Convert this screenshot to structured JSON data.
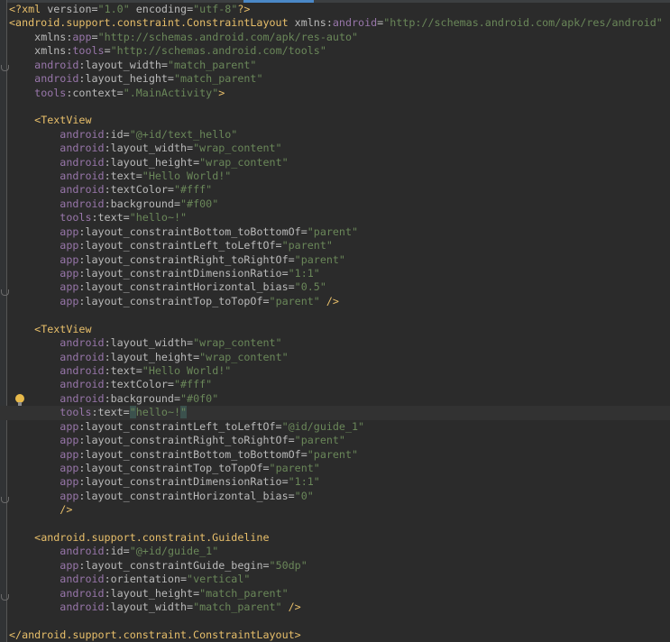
{
  "editor": {
    "lines": [
      {
        "i": 0,
        "k": [
          [
            "t",
            "<?xml "
          ],
          [
            "a",
            "version"
          ],
          [
            "a",
            "="
          ],
          [
            "v",
            "\"1.0\""
          ],
          [
            "a",
            " encoding"
          ],
          [
            "a",
            "="
          ],
          [
            "v",
            "\"utf-8\""
          ],
          [
            "t",
            "?>"
          ]
        ]
      },
      {
        "i": 0,
        "k": [
          [
            "t",
            "<android.support.constraint.ConstraintLayout "
          ],
          [
            "a",
            "xmlns"
          ],
          [
            "a",
            ":"
          ],
          [
            "n",
            "android"
          ],
          [
            "a",
            "="
          ],
          [
            "v",
            "\"http://schemas.android.com/apk/res/android\""
          ]
        ]
      },
      {
        "i": 1,
        "k": [
          [
            "a",
            "xmlns:"
          ],
          [
            "n",
            "app"
          ],
          [
            "a",
            "="
          ],
          [
            "v",
            "\"http://schemas.android.com/apk/res-auto\""
          ]
        ]
      },
      {
        "i": 1,
        "k": [
          [
            "a",
            "xmlns:"
          ],
          [
            "n",
            "tools"
          ],
          [
            "a",
            "="
          ],
          [
            "v",
            "\"http://schemas.android.com/tools\""
          ]
        ]
      },
      {
        "i": 1,
        "k": [
          [
            "n",
            "android"
          ],
          [
            "a",
            ":layout_width="
          ],
          [
            "v",
            "\"match_parent\""
          ]
        ]
      },
      {
        "i": 1,
        "k": [
          [
            "n",
            "android"
          ],
          [
            "a",
            ":layout_height="
          ],
          [
            "v",
            "\"match_parent\""
          ]
        ]
      },
      {
        "i": 1,
        "k": [
          [
            "n",
            "tools"
          ],
          [
            "a",
            ":context="
          ],
          [
            "v",
            "\".MainActivity\""
          ],
          [
            "t",
            ">"
          ]
        ]
      },
      {
        "i": 0,
        "k": []
      },
      {
        "i": 1,
        "k": [
          [
            "t",
            "<TextView"
          ]
        ]
      },
      {
        "i": 2,
        "k": [
          [
            "n",
            "android"
          ],
          [
            "a",
            ":id="
          ],
          [
            "v",
            "\"@+id/text_hello\""
          ]
        ]
      },
      {
        "i": 2,
        "k": [
          [
            "n",
            "android"
          ],
          [
            "a",
            ":layout_width="
          ],
          [
            "v",
            "\"wrap_content\""
          ]
        ]
      },
      {
        "i": 2,
        "k": [
          [
            "n",
            "android"
          ],
          [
            "a",
            ":layout_height="
          ],
          [
            "v",
            "\"wrap_content\""
          ]
        ]
      },
      {
        "i": 2,
        "k": [
          [
            "n",
            "android"
          ],
          [
            "a",
            ":text="
          ],
          [
            "v",
            "\"Hello World!\""
          ]
        ]
      },
      {
        "i": 2,
        "k": [
          [
            "n",
            "android"
          ],
          [
            "a",
            ":textColor="
          ],
          [
            "v",
            "\"#fff\""
          ]
        ]
      },
      {
        "i": 2,
        "k": [
          [
            "n",
            "android"
          ],
          [
            "a",
            ":background="
          ],
          [
            "v",
            "\"#f00\""
          ]
        ]
      },
      {
        "i": 2,
        "k": [
          [
            "n",
            "tools"
          ],
          [
            "a",
            ":text="
          ],
          [
            "v",
            "\"hello~!\""
          ]
        ]
      },
      {
        "i": 2,
        "k": [
          [
            "n",
            "app"
          ],
          [
            "a",
            ":layout_constraintBottom_toBottomOf="
          ],
          [
            "v",
            "\"parent\""
          ]
        ]
      },
      {
        "i": 2,
        "k": [
          [
            "n",
            "app"
          ],
          [
            "a",
            ":layout_constraintLeft_toLeftOf="
          ],
          [
            "v",
            "\"parent\""
          ]
        ]
      },
      {
        "i": 2,
        "k": [
          [
            "n",
            "app"
          ],
          [
            "a",
            ":layout_constraintRight_toRightOf="
          ],
          [
            "v",
            "\"parent\""
          ]
        ]
      },
      {
        "i": 2,
        "k": [
          [
            "n",
            "app"
          ],
          [
            "a",
            ":layout_constraintDimensionRatio="
          ],
          [
            "v",
            "\"1:1\""
          ]
        ]
      },
      {
        "i": 2,
        "k": [
          [
            "n",
            "app"
          ],
          [
            "a",
            ":layout_constraintHorizontal_bias="
          ],
          [
            "v",
            "\"0.5\""
          ]
        ]
      },
      {
        "i": 2,
        "k": [
          [
            "n",
            "app"
          ],
          [
            "a",
            ":layout_constraintTop_toTopOf="
          ],
          [
            "v",
            "\"parent\""
          ],
          [
            "t",
            " />"
          ]
        ]
      },
      {
        "i": 0,
        "k": []
      },
      {
        "i": 1,
        "k": [
          [
            "t",
            "<TextView"
          ]
        ]
      },
      {
        "i": 2,
        "k": [
          [
            "n",
            "android"
          ],
          [
            "a",
            ":layout_width="
          ],
          [
            "v",
            "\"wrap_content\""
          ]
        ]
      },
      {
        "i": 2,
        "k": [
          [
            "n",
            "android"
          ],
          [
            "a",
            ":layout_height="
          ],
          [
            "v",
            "\"wrap_content\""
          ]
        ]
      },
      {
        "i": 2,
        "k": [
          [
            "n",
            "android"
          ],
          [
            "a",
            ":text="
          ],
          [
            "v",
            "\"Hello World!\""
          ]
        ]
      },
      {
        "i": 2,
        "k": [
          [
            "n",
            "android"
          ],
          [
            "a",
            ":textColor="
          ],
          [
            "v",
            "\"#fff\""
          ]
        ]
      },
      {
        "i": 2,
        "k": [
          [
            "n",
            "android"
          ],
          [
            "a",
            ":background="
          ],
          [
            "v",
            "\"#0f0\""
          ]
        ]
      },
      {
        "i": 2,
        "hl": true,
        "k": [
          [
            "n",
            "tools"
          ],
          [
            "a",
            ":text="
          ],
          [
            "v q",
            "\""
          ],
          [
            "v",
            "hello~!"
          ],
          [
            "v q",
            "\""
          ]
        ]
      },
      {
        "i": 2,
        "k": [
          [
            "n",
            "app"
          ],
          [
            "a",
            ":layout_constraintLeft_toLeftOf="
          ],
          [
            "v",
            "\"@id/guide_1\""
          ]
        ]
      },
      {
        "i": 2,
        "k": [
          [
            "n",
            "app"
          ],
          [
            "a",
            ":layout_constraintRight_toRightOf="
          ],
          [
            "v",
            "\"parent\""
          ]
        ]
      },
      {
        "i": 2,
        "k": [
          [
            "n",
            "app"
          ],
          [
            "a",
            ":layout_constraintBottom_toBottomOf="
          ],
          [
            "v",
            "\"parent\""
          ]
        ]
      },
      {
        "i": 2,
        "k": [
          [
            "n",
            "app"
          ],
          [
            "a",
            ":layout_constraintTop_toTopOf="
          ],
          [
            "v",
            "\"parent\""
          ]
        ]
      },
      {
        "i": 2,
        "k": [
          [
            "n",
            "app"
          ],
          [
            "a",
            ":layout_constraintDimensionRatio="
          ],
          [
            "v",
            "\"1:1\""
          ]
        ]
      },
      {
        "i": 2,
        "k": [
          [
            "n",
            "app"
          ],
          [
            "a",
            ":layout_constraintHorizontal_bias="
          ],
          [
            "v",
            "\"0\""
          ]
        ]
      },
      {
        "i": 2,
        "k": [
          [
            "t",
            "/>"
          ]
        ]
      },
      {
        "i": 0,
        "k": []
      },
      {
        "i": 1,
        "k": [
          [
            "t",
            "<android.support.constraint.Guideline"
          ]
        ]
      },
      {
        "i": 2,
        "k": [
          [
            "n",
            "android"
          ],
          [
            "a",
            ":id="
          ],
          [
            "v",
            "\"@+id/guide_1\""
          ]
        ]
      },
      {
        "i": 2,
        "k": [
          [
            "n",
            "app"
          ],
          [
            "a",
            ":layout_constraintGuide_begin="
          ],
          [
            "v",
            "\"50dp\""
          ]
        ]
      },
      {
        "i": 2,
        "k": [
          [
            "n",
            "android"
          ],
          [
            "a",
            ":orientation="
          ],
          [
            "v",
            "\"vertical\""
          ]
        ]
      },
      {
        "i": 2,
        "k": [
          [
            "n",
            "android"
          ],
          [
            "a",
            ":layout_height="
          ],
          [
            "v",
            "\"match_parent\""
          ]
        ]
      },
      {
        "i": 2,
        "k": [
          [
            "n",
            "android"
          ],
          [
            "a",
            ":layout_width="
          ],
          [
            "v",
            "\"match_parent\""
          ],
          [
            "t",
            " />"
          ]
        ]
      },
      {
        "i": 0,
        "k": []
      },
      {
        "i": 0,
        "k": [
          [
            "t",
            "</android.support.constraint.ConstraintLayout>"
          ]
        ]
      }
    ]
  }
}
